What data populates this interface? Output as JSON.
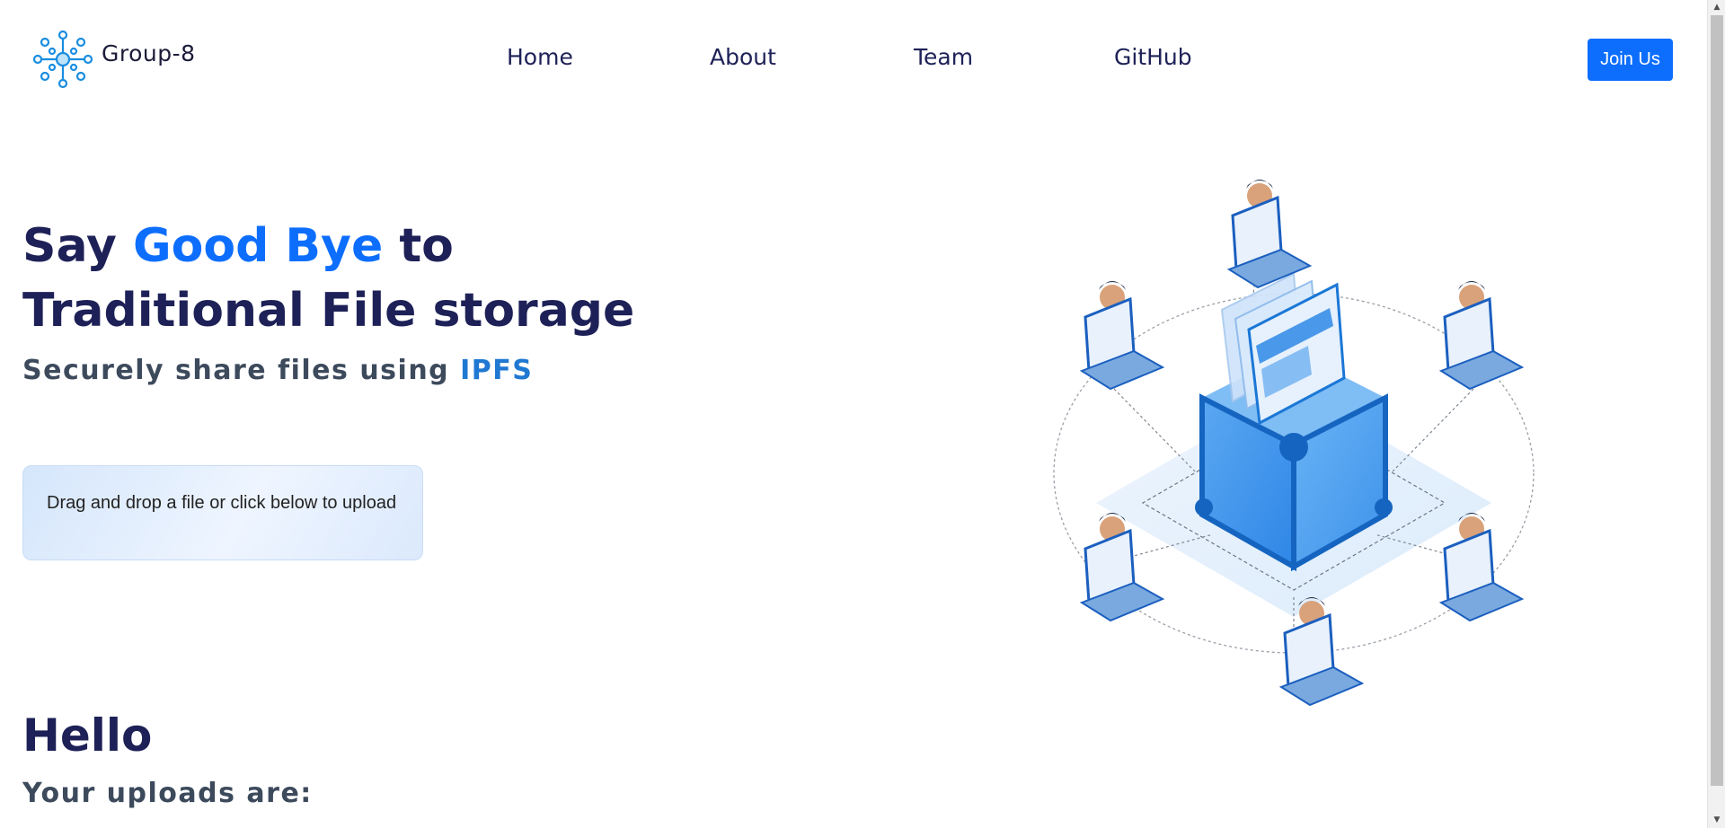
{
  "header": {
    "brand": "Group-8",
    "nav": {
      "home": "Home",
      "about": "About",
      "team": "Team",
      "github": "GitHub"
    },
    "join_label": "Join Us"
  },
  "hero": {
    "title_part1": "Say ",
    "title_highlight": "Good Bye",
    "title_part2": " to",
    "title_line2": "Traditional File storage",
    "subtitle_part1": "Securely share files using ",
    "subtitle_highlight": "IPFS",
    "upload_text": "Drag and drop a file or click below to upload"
  },
  "uploads_section": {
    "greeting": "Hello",
    "label": "Your uploads are:"
  },
  "colors": {
    "accent": "#0d6efd",
    "heading": "#1e2157",
    "subheading": "#3c4a5c",
    "ipfs": "#1f78d1"
  },
  "icons": {
    "logo": "network-nodes-logo-icon",
    "illustration": "ipfs-network-cube-illustration"
  }
}
